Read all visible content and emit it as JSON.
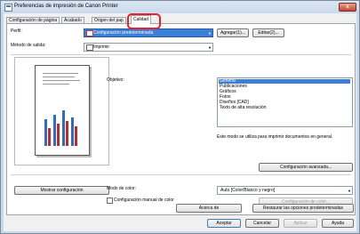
{
  "window": {
    "title": "Preferencias de impresión de Canon Printer",
    "close_glyph": "x"
  },
  "tabs": [
    {
      "label": "Configuración de página"
    },
    {
      "label": "Acabado"
    },
    {
      "label": "Origen del pap"
    },
    {
      "label": "Calidad"
    }
  ],
  "profile": {
    "label": "Perfil:",
    "value": "Configuración predeterminada",
    "add_label": "Agregar(1)...",
    "edit_label": "Editar(2)..."
  },
  "output": {
    "label": "Método de salida:",
    "value": "Imprimir"
  },
  "objective": {
    "label": "Objetivo:",
    "items": [
      "General",
      "Publicaciones",
      "Gráficos",
      "Fotos",
      "Diseños [CAD]",
      "Texto de alta resolución"
    ],
    "selected": "General",
    "description": "Este modo se utiliza para imprimir documentos en general."
  },
  "advanced_button": "Configuración avanzada...",
  "show_settings_button": "Mostrar configuración",
  "color": {
    "mode_label": "Modo de color:",
    "mode_value": "Auto [Color/Blanco y negro]",
    "manual_label": "Configuración manual de color",
    "settings_button": "Configuración de color..."
  },
  "about_button": "Acerca de",
  "restore_button": "Restaurar las opciones predeterminadas",
  "footer": {
    "ok": "Aceptar",
    "cancel": "Cancelar",
    "apply": "Aplicar",
    "help": "Ayuda"
  },
  "colors": {
    "accent": "#3b7fd6",
    "highlight_ring": "#e8202a"
  }
}
